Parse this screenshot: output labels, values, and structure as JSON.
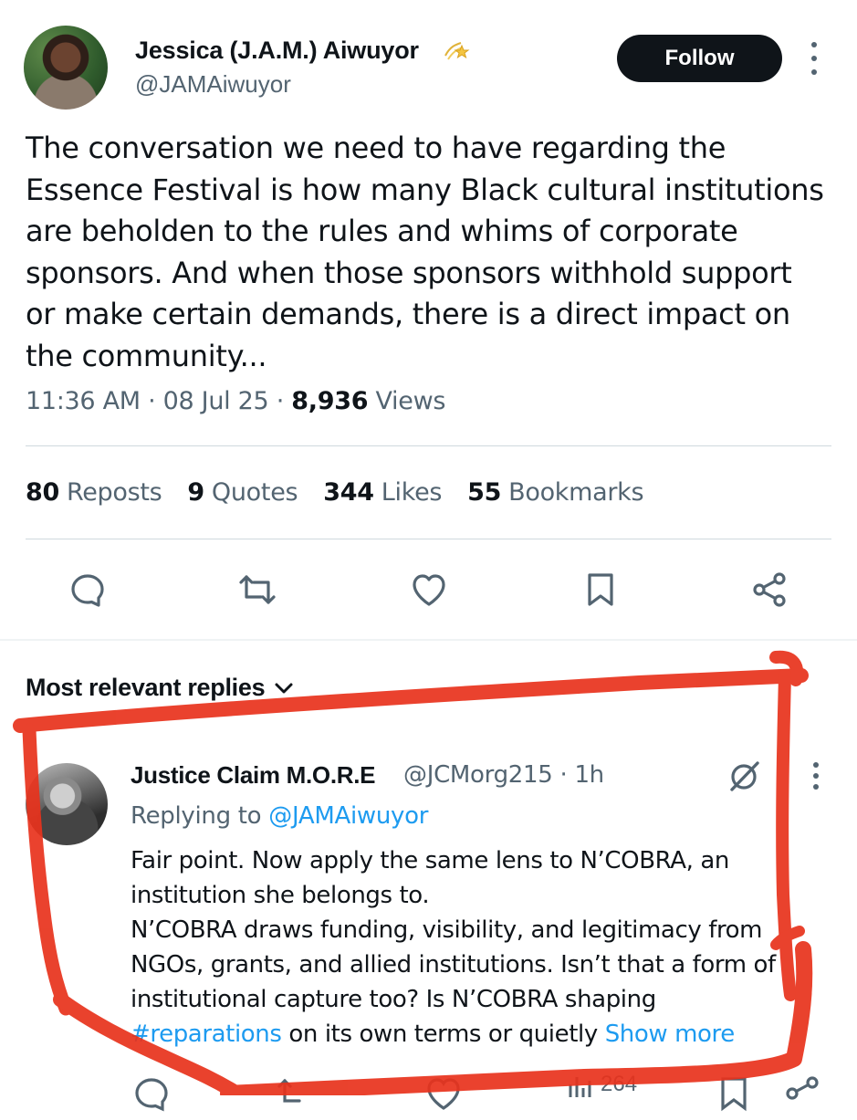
{
  "author": {
    "name": "Jessica (J.A.M.) Aiwuyor",
    "handle": "@JAMAiwuyor",
    "follow_label": "Follow"
  },
  "tweet": {
    "lines": [
      "The conversation we need to have regarding the",
      "Essence Festival is how many Black cultural institutions",
      "are beholden to the rules and whims of corporate",
      "sponsors. And when those sponsors withhold support",
      "or make certain demands, there is a direct impact on",
      "the community..."
    ],
    "time": "11:36 AM",
    "date": "08 Jul 25",
    "views_count": "8,936",
    "views_label": "Views"
  },
  "stats": {
    "reposts_count": "80",
    "reposts_label": "Reposts",
    "quotes_count": "9",
    "quotes_label": "Quotes",
    "likes_count": "344",
    "likes_label": "Likes",
    "bookmarks_count": "55",
    "bookmarks_label": "Bookmarks"
  },
  "actions": {
    "icons": [
      "reply-icon",
      "repost-icon",
      "like-icon",
      "bookmark-icon",
      "share-icon"
    ]
  },
  "replies": {
    "header": "Most relevant replies"
  },
  "reply": {
    "name": "Justice Claim M.O.R.E",
    "handle": "@JCMorg215",
    "age": "1h",
    "replying_prefix": "Replying to",
    "replying_to": "@JAMAiwuyor",
    "lines": [
      "Fair point. Now apply the same lens to N’COBRA, an",
      "institution she belongs to.",
      "N’COBRA draws funding, visibility, and legitimacy from",
      "NGOs, grants, and allied institutions. Isn’t that a form of",
      "institutional capture too? Is N’COBRA shaping"
    ],
    "hashtag": "#reparations",
    "last_line_rest": " on its own terms or quietly",
    "show_more": "Show more",
    "views_partial": "264"
  },
  "colors": {
    "text": "#0f1419",
    "secondary": "#536471",
    "link": "#1d9bf0",
    "annotation": "#e8321c"
  }
}
